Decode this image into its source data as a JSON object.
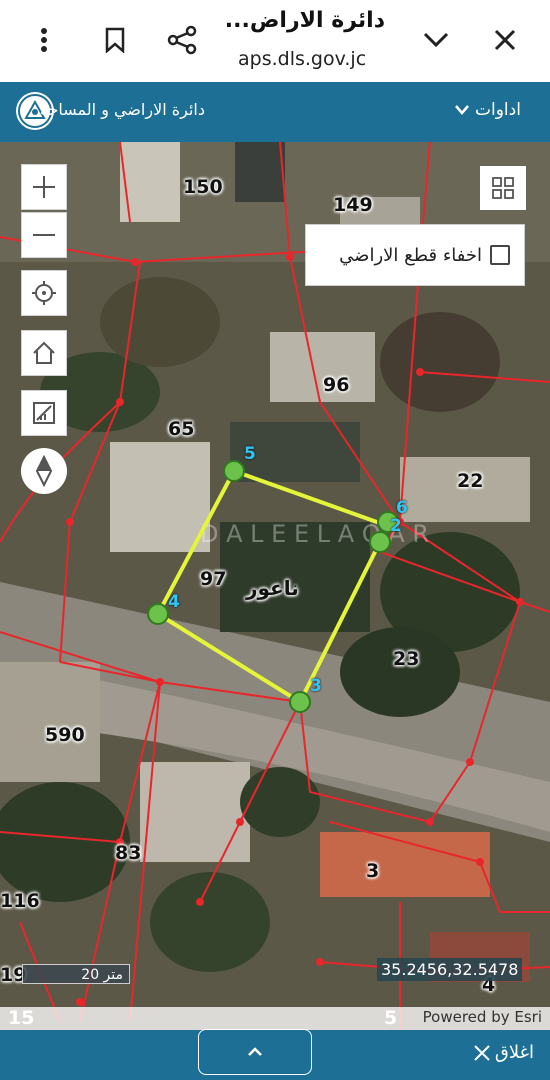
{
  "browser": {
    "title": "دائرة الاراض...",
    "url": "aps.dls.gov.jc",
    "icons": [
      "more-vert-icon",
      "bookmark-icon",
      "share-icon",
      "chevron-down-icon",
      "close-icon"
    ]
  },
  "header": {
    "tools_label": "اداوات",
    "site_title": "دائرة الاراضي و المساحة"
  },
  "map": {
    "hide_parcels_label": "اخفاء قطع الاراضي",
    "hide_parcels_checked": false,
    "parcels": [
      "150",
      "149",
      "96",
      "65",
      "22",
      "97",
      "23",
      "590",
      "83",
      "3",
      "116",
      "19",
      "4",
      "15",
      "5"
    ],
    "place_label": "ناعور",
    "vertices": [
      "5",
      "6",
      "2",
      "4",
      "3"
    ],
    "watermark": "دليل عقار DALEEL AQAR",
    "scale_label": "20 متر",
    "coordinates": "35.2456,32.5478",
    "attribution": "Powered by Esri",
    "tools": [
      "zoom-in-icon",
      "zoom-out-icon",
      "locate-icon",
      "home-icon",
      "measure-icon",
      "compass-icon"
    ]
  },
  "bottom": {
    "close_label": "اغلاق"
  },
  "colors": {
    "accent": "#1d6f96",
    "parcel_line": "#e8262b",
    "selection": "#e5f53a",
    "vertex": "#6cc24a"
  }
}
